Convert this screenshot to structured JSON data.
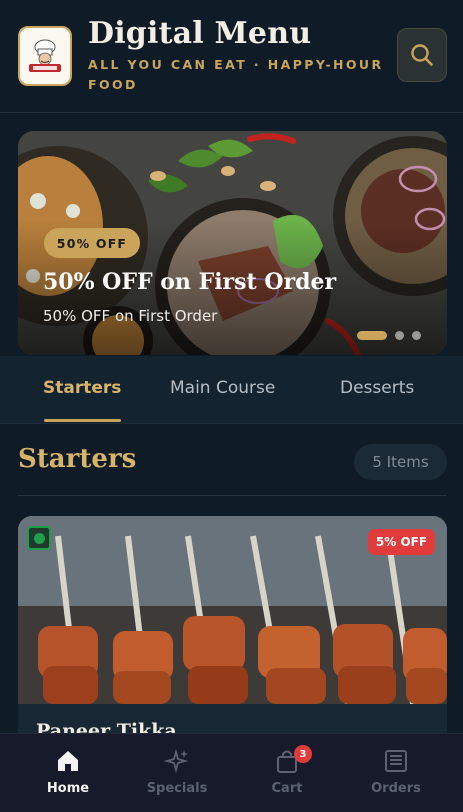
{
  "header": {
    "title": "Digital Menu",
    "subtitle": "ALL YOU CAN EAT · HAPPY-HOUR FOOD",
    "logo_icon": "chef-logo-icon",
    "search_icon": "search-icon"
  },
  "banner": {
    "badge": "50% OFF",
    "title": "50% OFF on First Order",
    "subtitle": "50% OFF on First Order",
    "slides_total": 3,
    "active_slide": 1
  },
  "tabs": [
    {
      "label": "Starters",
      "active": true
    },
    {
      "label": "Main Course",
      "active": false
    },
    {
      "label": "Desserts",
      "active": false
    }
  ],
  "section": {
    "title": "Starters",
    "count": "5 Items"
  },
  "card": {
    "discount": "5% OFF",
    "title": "Paneer Tikka",
    "veg": true
  },
  "bottom_nav": {
    "items": [
      {
        "label": "Home",
        "icon": "home-icon",
        "active": true
      },
      {
        "label": "Specials",
        "icon": "sparkle-icon",
        "active": false
      },
      {
        "label": "Cart",
        "icon": "bag-icon",
        "active": false,
        "badge": "3"
      },
      {
        "label": "Orders",
        "icon": "receipt-icon",
        "active": false
      }
    ]
  },
  "colors": {
    "background": "#0f1c27",
    "accent_gold": "#c9a45a",
    "badge_red": "#e23b3b",
    "veg_green": "#1f9f4a"
  }
}
